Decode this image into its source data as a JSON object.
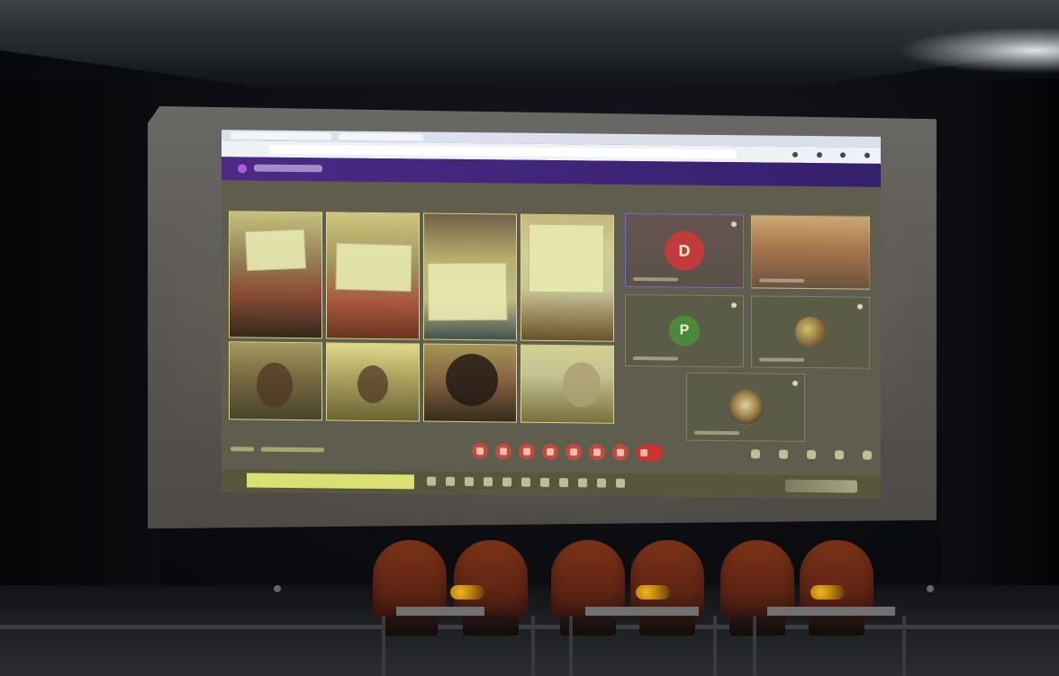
{
  "screen": {
    "participant_initials": {
      "d": "D",
      "p": "P"
    }
  }
}
